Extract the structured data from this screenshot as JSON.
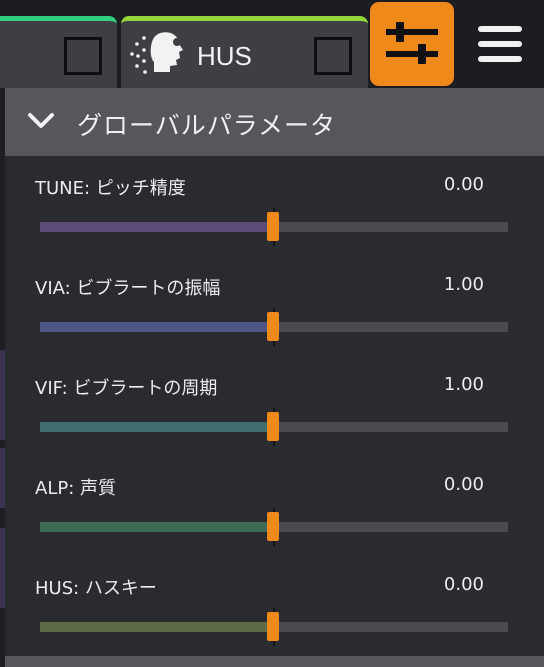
{
  "tabs": [
    {
      "accent": "#2fcf7d",
      "label": ""
    },
    {
      "accent": "#94d63a",
      "label": "HUS",
      "icon": "voice-head-icon"
    }
  ],
  "toolbar": {
    "params_icon": "sliders-icon",
    "params_color": "#ef8a1a",
    "menu_icon": "hamburger-menu-icon"
  },
  "panel": {
    "title": "グローバルパラメータ",
    "collapse_icon": "chevron-down-icon",
    "parameters": [
      {
        "label": "TUNE: ピッチ精度",
        "value": "0.00",
        "level": 0.5,
        "color": "#5a4b7a"
      },
      {
        "label": "VIA: ビブラートの振幅",
        "value": "1.00",
        "level": 0.5,
        "color": "#4c5585"
      },
      {
        "label": "VIF: ビブラートの周期",
        "value": "1.00",
        "level": 0.5,
        "color": "#3f6d70"
      },
      {
        "label": "ALP: 声質",
        "value": "0.00",
        "level": 0.5,
        "color": "#3e6b55"
      },
      {
        "label": "HUS: ハスキー",
        "value": "0.00",
        "level": 0.5,
        "color": "#5d6a46"
      }
    ]
  }
}
